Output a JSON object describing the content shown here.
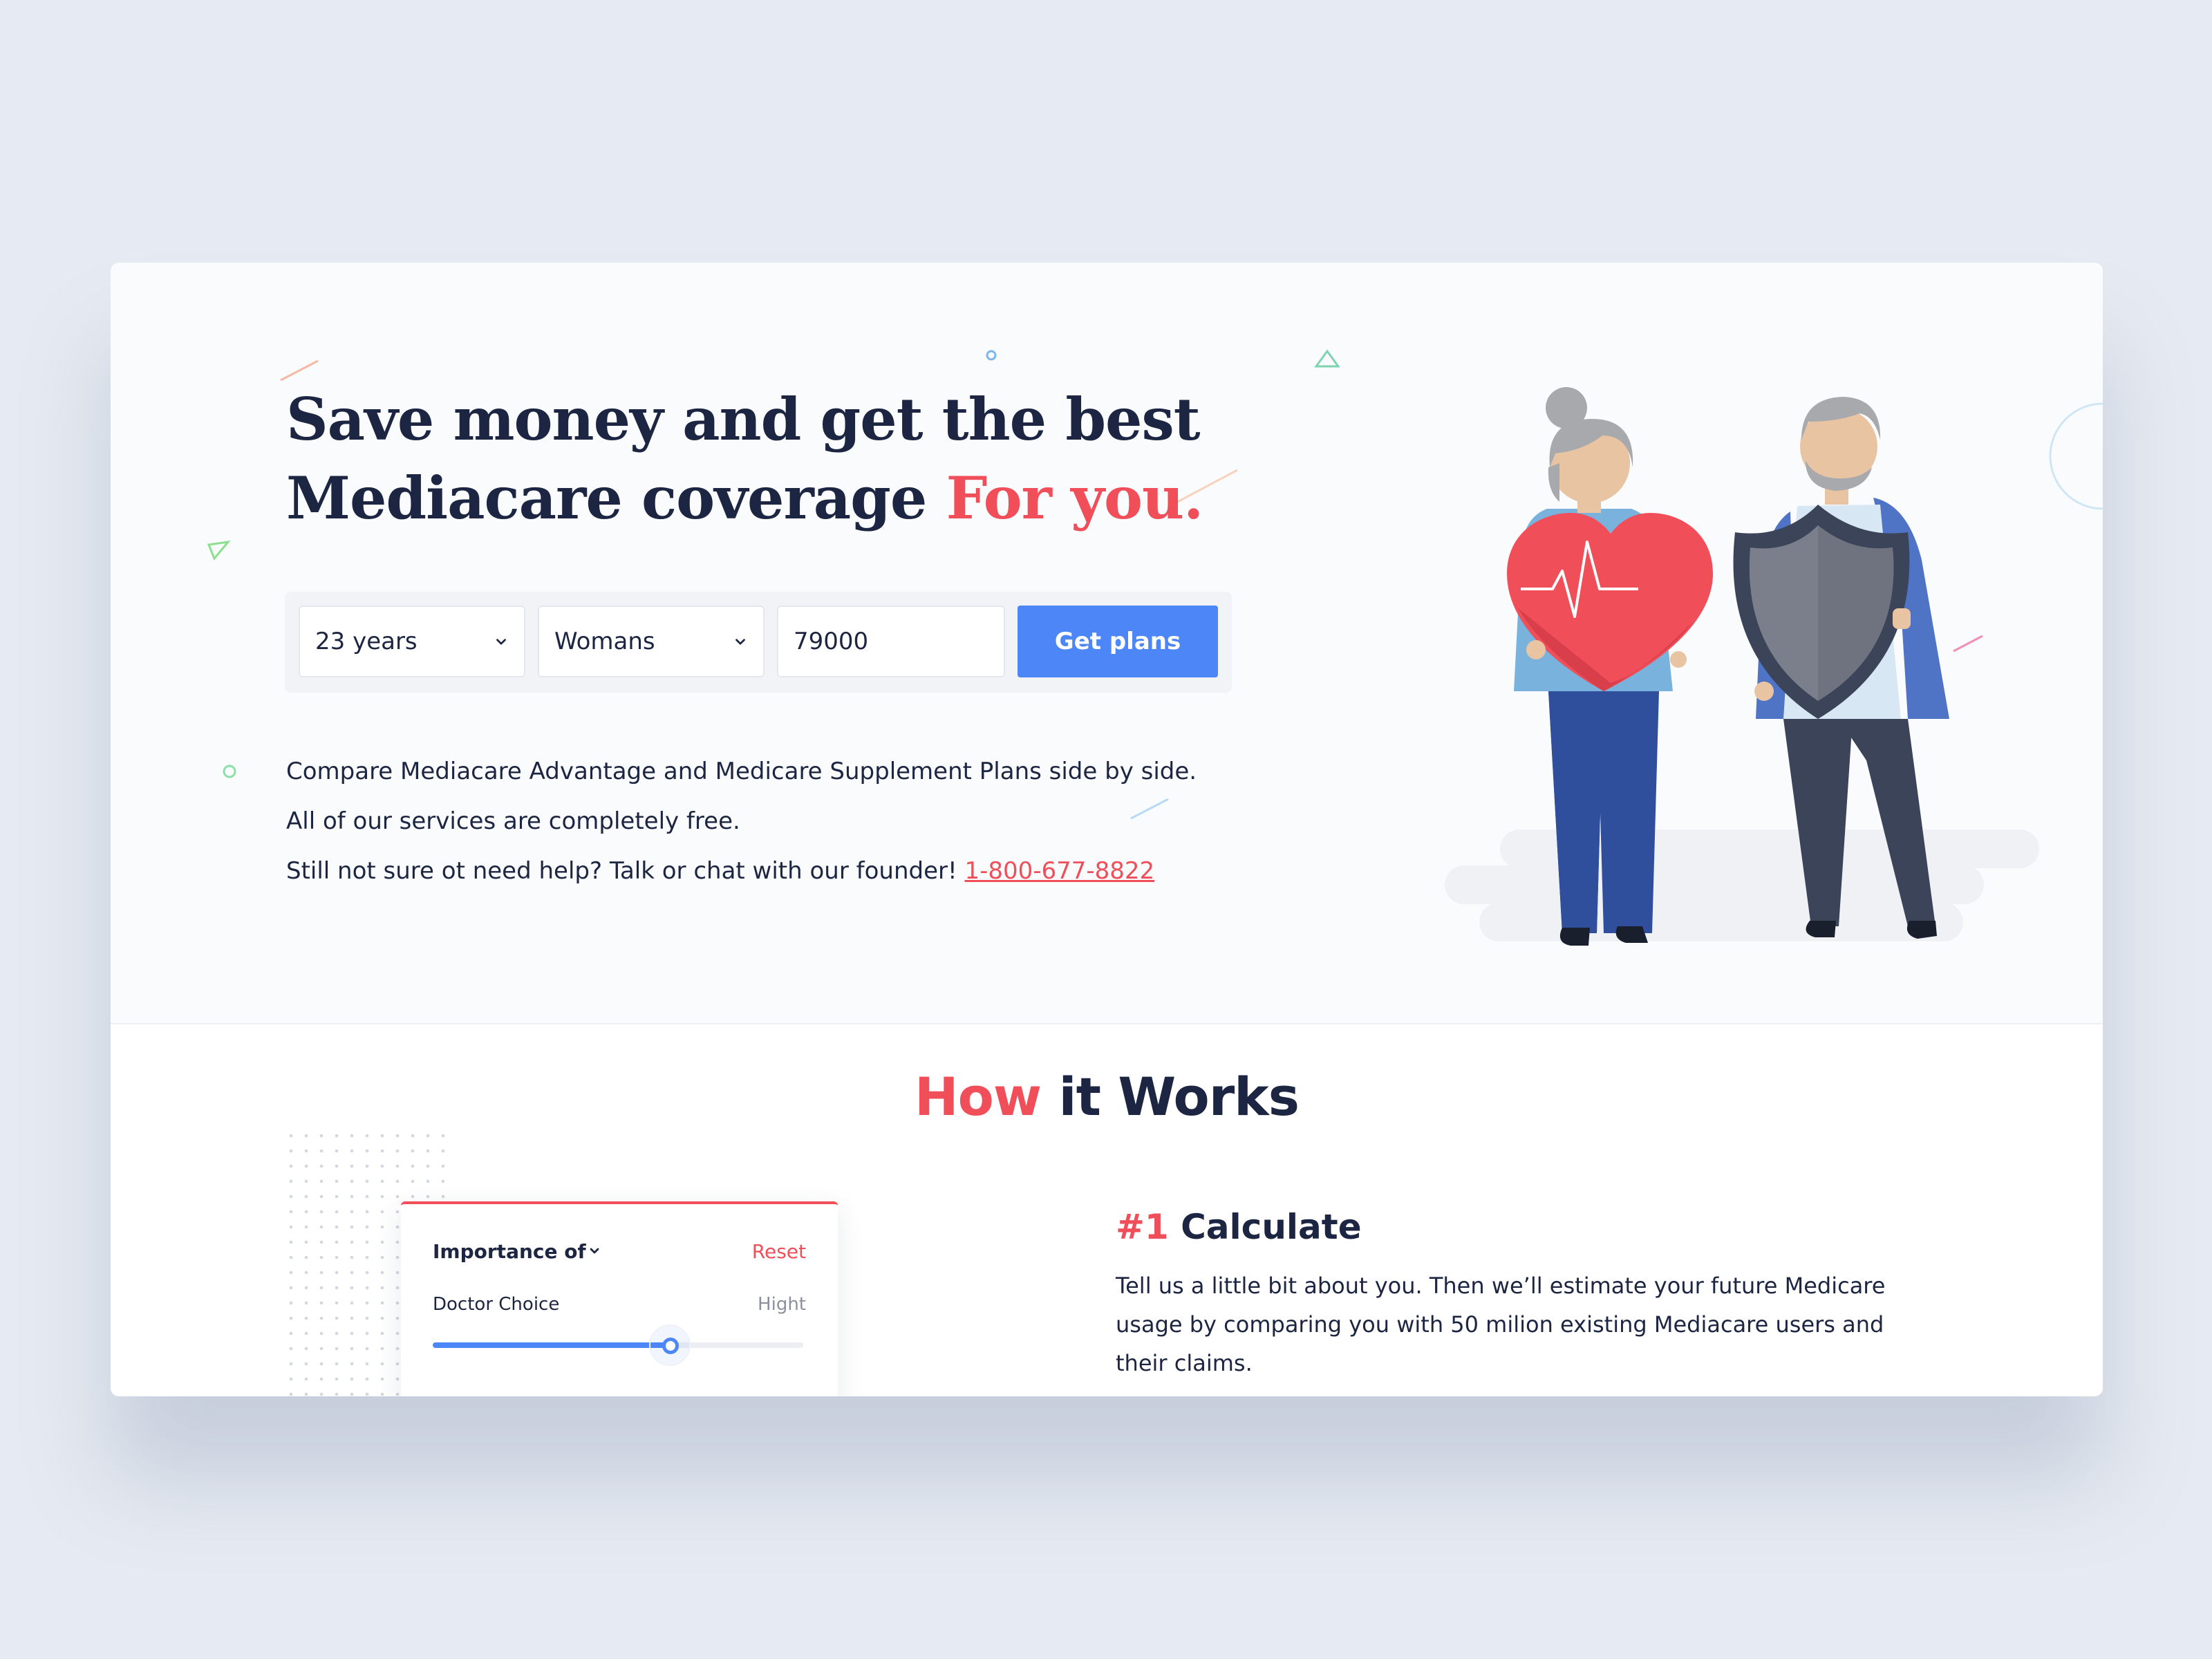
{
  "hero": {
    "headline_line1": "Save money and get the best",
    "headline_line2": "Mediacare coverage",
    "headline_accent": "For you.",
    "form": {
      "age": "23 years",
      "gender": "Womans",
      "zip": "79000",
      "submit_label": "Get plans"
    },
    "description": [
      "Compare Mediacare Advantage and Medicare Supplement Plans side by side.",
      "All of our services are completely free.",
      "Still not sure ot need help? Talk or chat with our founder!"
    ],
    "phone": "1-800-677-8822"
  },
  "how": {
    "title_accent": "How",
    "title_rest": "it Works",
    "panel": {
      "title": "Importance of",
      "reset_label": "Reset",
      "criterion_label": "Doctor Choice",
      "criterion_value": "Hight",
      "slider_level": 0.64
    },
    "step": {
      "number": "#1",
      "title": "Calculate",
      "text": "Tell us a little bit about you. Then we’ll estimate your future Medicare usage by comparing you with 50 milion existing Mediacare users and their claims."
    }
  },
  "colors": {
    "accent_red": "#f04f5a",
    "primary_blue": "#4d86f7",
    "text_dark": "#1c2541",
    "page_bg": "#e6eaf2"
  },
  "icons": [
    "chevron-down-icon",
    "heart-icon",
    "shield-icon"
  ]
}
